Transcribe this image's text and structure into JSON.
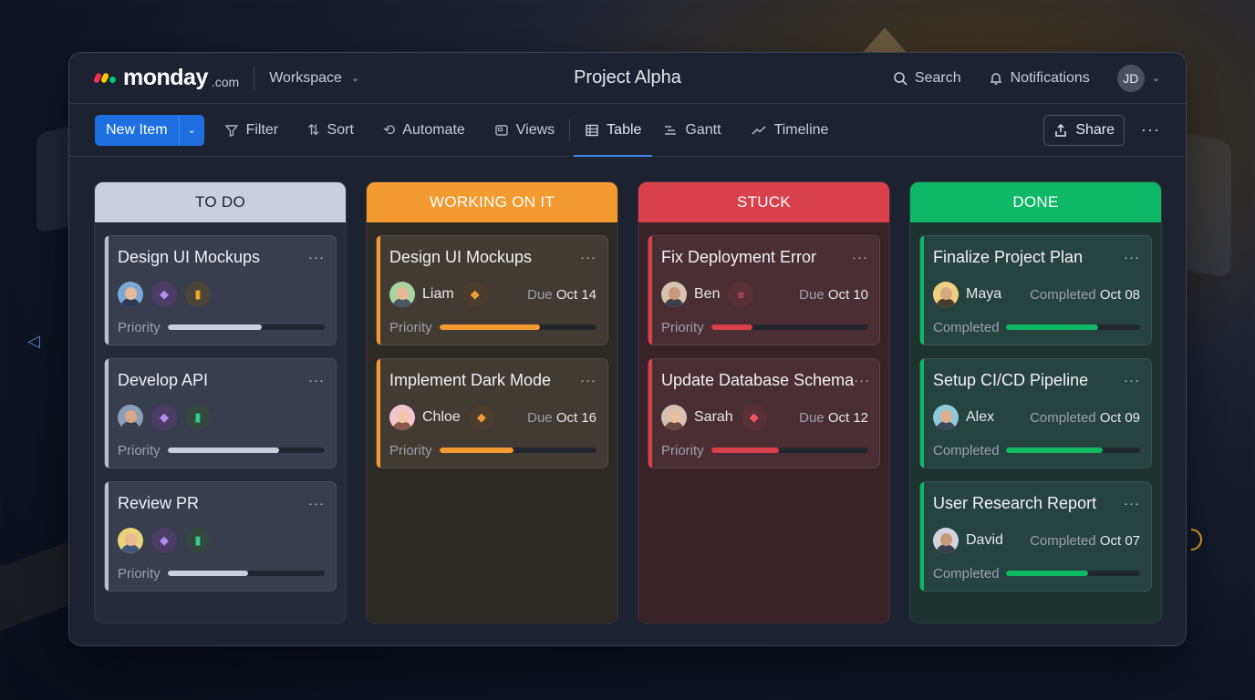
{
  "app": {
    "logo_text": "monday",
    "logo_suffix": ".com",
    "workspace_label": "Workspace",
    "project_title": "Project Alpha",
    "search_label": "Search",
    "notifications_label": "Notifications",
    "user_initials": "JD"
  },
  "toolbar": {
    "new_item_label": "New Item",
    "filter_label": "Filter",
    "sort_label": "Sort",
    "automate_label": "Automate",
    "views_label": "Views",
    "table_label": "Table",
    "gantt_label": "Gantt",
    "timeline_label": "Timeline",
    "share_label": "Share"
  },
  "colors": {
    "accent": "#1e6fe0",
    "todo": "#c9cfdb",
    "working": "#f39a30",
    "stuck": "#d8414c",
    "done": "#0fb865"
  },
  "columns": [
    {
      "title": "TO DO",
      "cards": [
        {
          "title": "Design UI Mockups",
          "priority_label": "Priority",
          "progress": 0.6,
          "chips": [
            "layers-icon",
            "bar-chart-icon"
          ]
        },
        {
          "title": "Develop API",
          "priority_label": "Priority",
          "progress": 0.71,
          "chips": [
            "layers-icon",
            "bar-chart-icon"
          ]
        },
        {
          "title": "Review PR",
          "priority_label": "Priority",
          "progress": 0.51,
          "chips": [
            "layers-icon",
            "bar-chart-icon"
          ]
        }
      ]
    },
    {
      "title": "WORKING ON IT",
      "cards": [
        {
          "title": "Design UI Mockups",
          "person": "Liam",
          "due_prefix": "Due",
          "due_date": "Oct 14",
          "priority_label": "Priority",
          "progress": 0.64
        },
        {
          "title": "Implement Dark Mode",
          "person": "Chloe",
          "due_prefix": "Due",
          "due_date": "Oct 16",
          "priority_label": "Priority",
          "progress": 0.47
        }
      ]
    },
    {
      "title": "STUCK",
      "cards": [
        {
          "title": "Fix Deployment Error",
          "person": "Ben",
          "due_prefix": "Due",
          "due_date": "Oct 10",
          "priority_label": "Priority",
          "progress": 0.26
        },
        {
          "title": "Update Database Schema",
          "person": "Sarah",
          "due_prefix": "Due",
          "due_date": "Oct 12",
          "priority_label": "Priority",
          "progress": 0.43
        }
      ]
    },
    {
      "title": "DONE",
      "cards": [
        {
          "title": "Finalize Project Plan",
          "person": "Maya",
          "due_prefix": "Completed",
          "due_date": "Oct 08",
          "priority_label": "Completed",
          "progress": 0.69
        },
        {
          "title": "Setup CI/CD Pipeline",
          "person": "Alex",
          "due_prefix": "Completed",
          "due_date": "Oct 09",
          "priority_label": "Completed",
          "progress": 0.72
        },
        {
          "title": "User Research Report",
          "person": "David",
          "due_prefix": "Completed",
          "due_date": "Oct 07",
          "priority_label": "Completed",
          "progress": 0.61
        }
      ]
    }
  ]
}
